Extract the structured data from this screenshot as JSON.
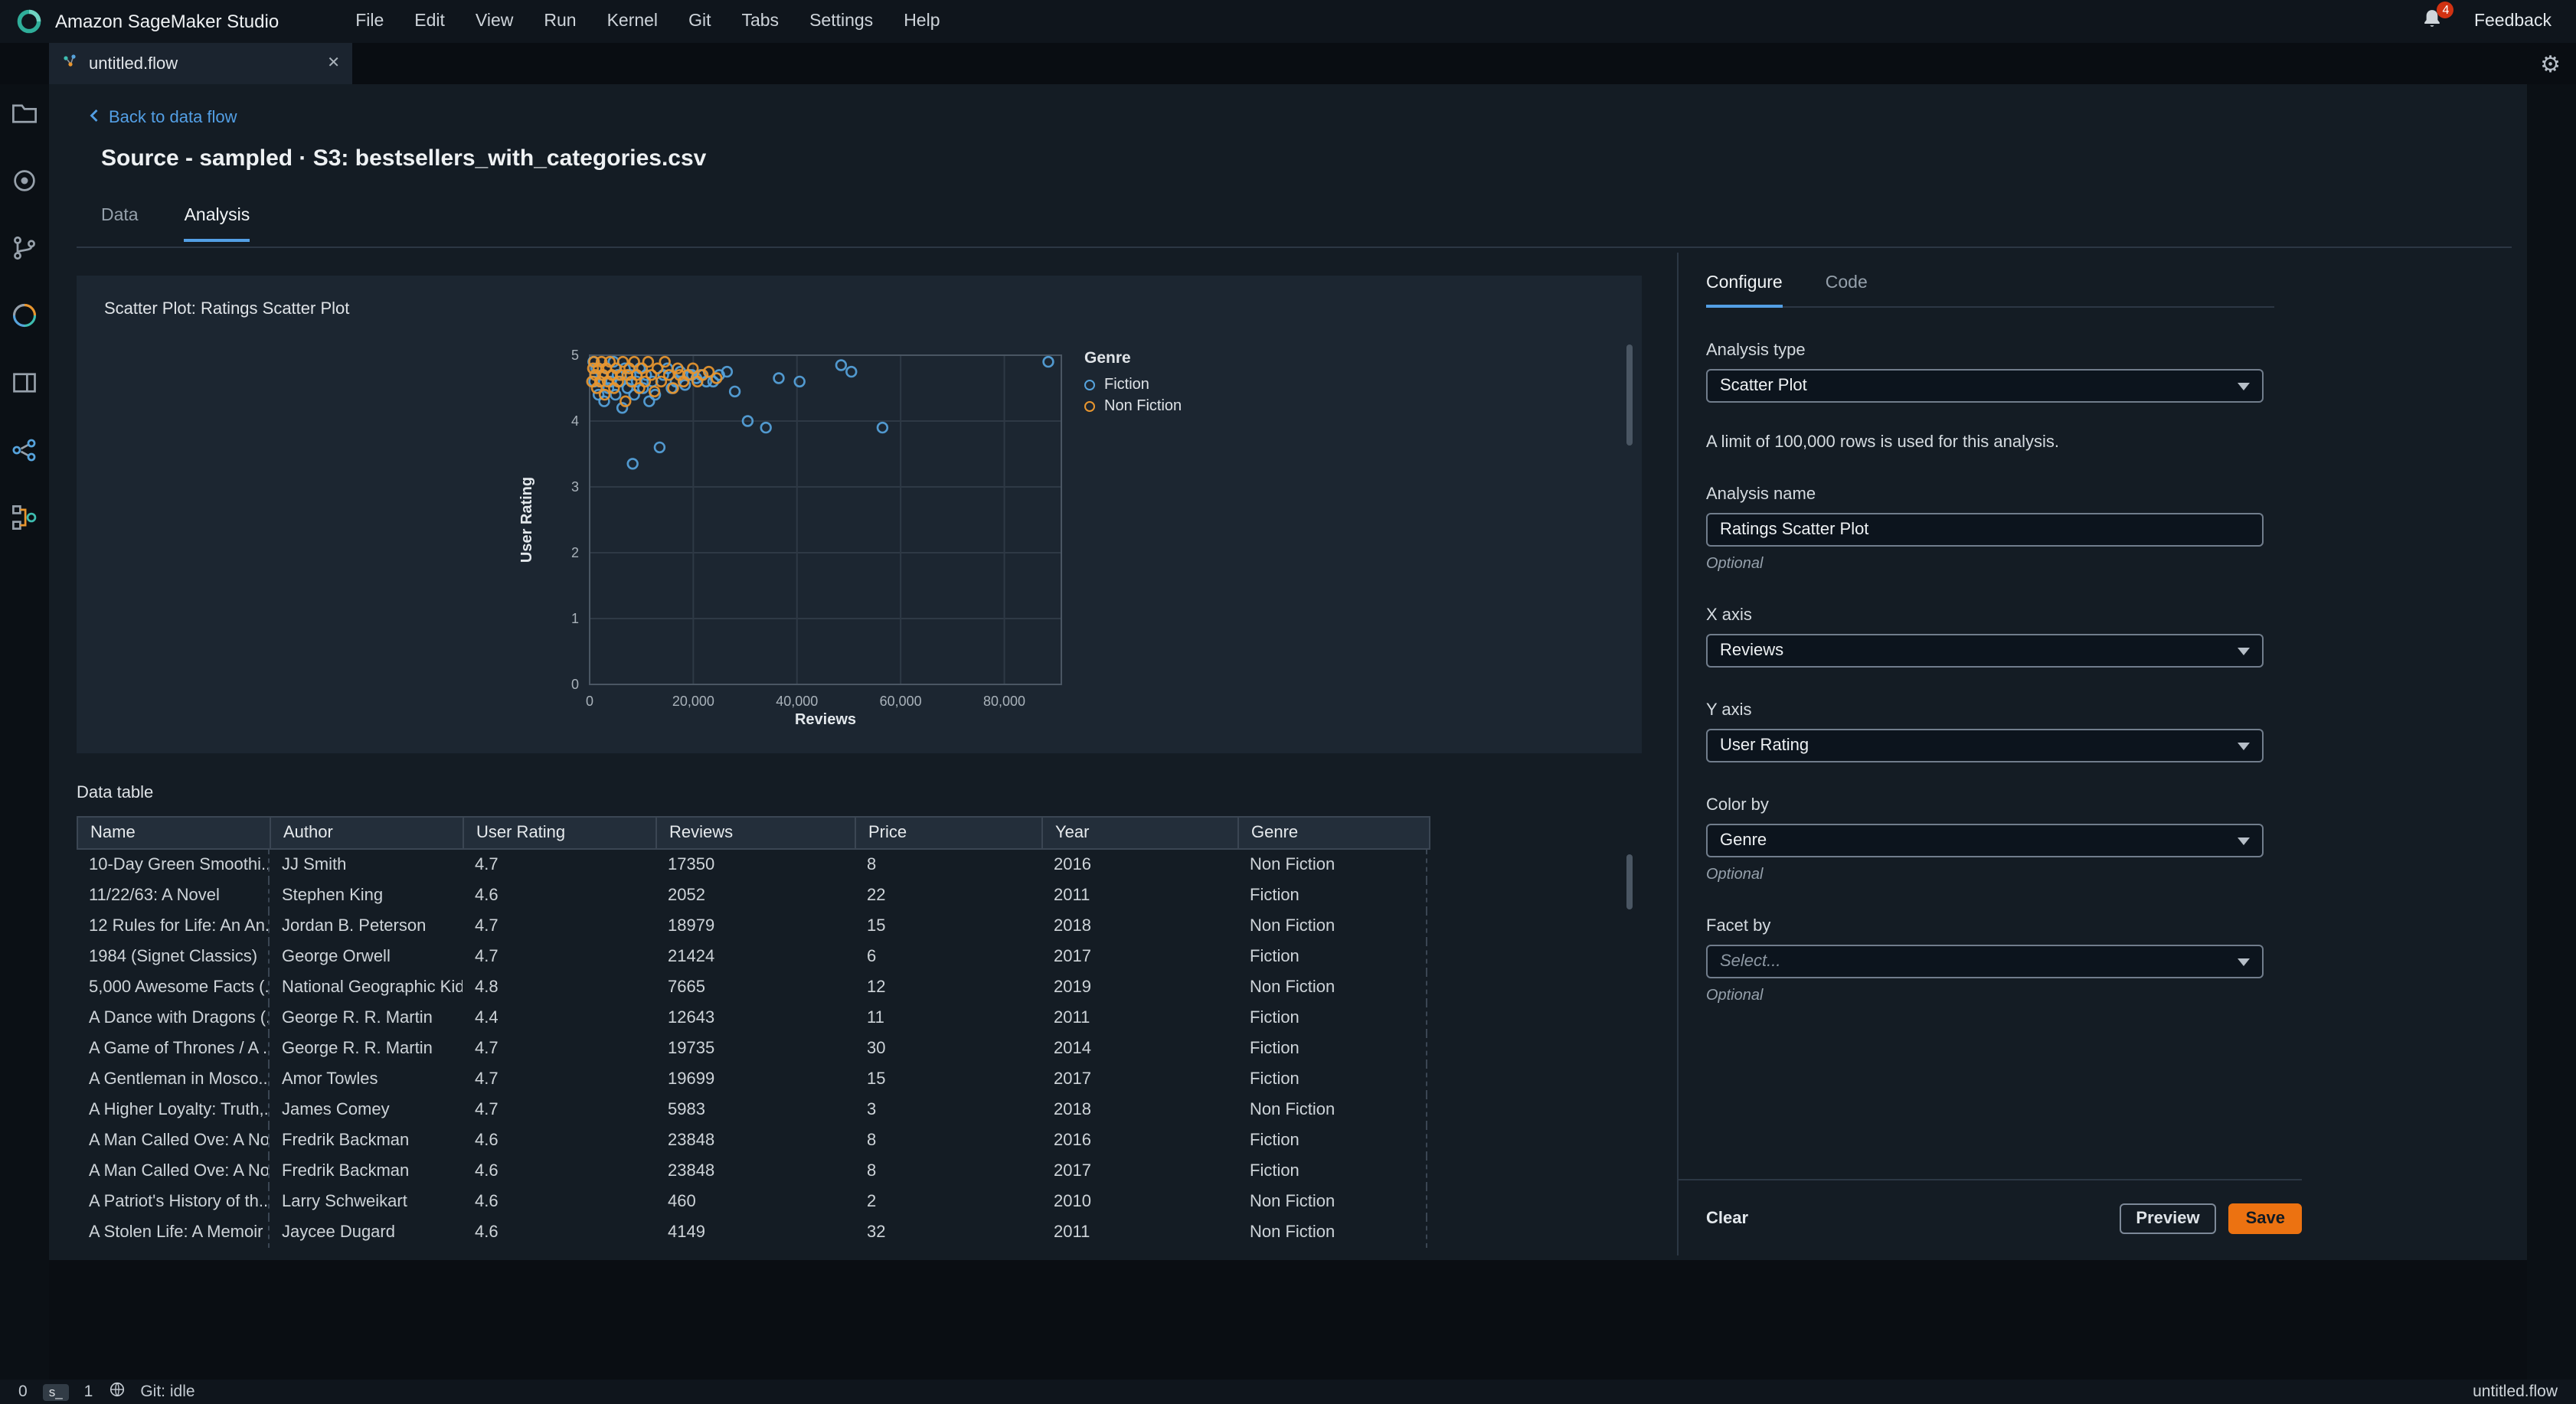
{
  "topbar": {
    "app_title": "Amazon SageMaker Studio",
    "menus": [
      "File",
      "Edit",
      "View",
      "Run",
      "Kernel",
      "Git",
      "Tabs",
      "Settings",
      "Help"
    ],
    "notification_count": "4",
    "feedback_label": "Feedback"
  },
  "tabbar": {
    "tab_title": "untitled.flow",
    "close_glyph": "✕"
  },
  "sidebar": {
    "icons": [
      "folder-icon",
      "running-icon",
      "git-icon",
      "resources-icon",
      "tabs-icon",
      "pipeline-icon",
      "data-flow-icon"
    ]
  },
  "page": {
    "back_link": "Back to data flow",
    "title": "Source - sampled · S3: bestsellers_with_categories.csv",
    "tabs": [
      {
        "label": "Data",
        "active": false
      },
      {
        "label": "Analysis",
        "active": true
      }
    ]
  },
  "chart_panel": {
    "title": "Scatter Plot: Ratings Scatter Plot"
  },
  "chart_data": {
    "type": "scatter",
    "title": "Scatter Plot: Ratings Scatter Plot",
    "xlabel": "Reviews",
    "ylabel": "User Rating",
    "xlim": [
      0,
      91000
    ],
    "ylim": [
      0,
      5
    ],
    "x_ticks": [
      0,
      20000,
      40000,
      60000,
      80000
    ],
    "x_tick_labels": [
      "0",
      "20,000",
      "40,000",
      "60,000",
      "80,000"
    ],
    "y_ticks": [
      0,
      1,
      2,
      3,
      4,
      5
    ],
    "grid": true,
    "legend_title": "Genre",
    "legend_position": "right",
    "series": [
      {
        "name": "Fiction",
        "color": "#56a3dc",
        "points": [
          [
            700,
            4.9
          ],
          [
            900,
            4.6
          ],
          [
            1300,
            4.8
          ],
          [
            1700,
            4.4
          ],
          [
            2052,
            4.6
          ],
          [
            2400,
            4.7
          ],
          [
            2800,
            4.3
          ],
          [
            3200,
            4.8
          ],
          [
            3600,
            4.5
          ],
          [
            4149,
            4.6
          ],
          [
            4600,
            4.9
          ],
          [
            5000,
            4.4
          ],
          [
            5400,
            4.7
          ],
          [
            5900,
            4.6
          ],
          [
            6300,
            4.2
          ],
          [
            6800,
            4.8
          ],
          [
            7300,
            4.5
          ],
          [
            7900,
            4.7
          ],
          [
            8300,
            3.35
          ],
          [
            8600,
            4.4
          ],
          [
            9100,
            4.6
          ],
          [
            9700,
            4.8
          ],
          [
            10300,
            4.5
          ],
          [
            10900,
            4.7
          ],
          [
            11500,
            4.3
          ],
          [
            12100,
            4.6
          ],
          [
            12643,
            4.4
          ],
          [
            13500,
            3.6
          ],
          [
            14200,
            4.7
          ],
          [
            15000,
            4.8
          ],
          [
            15800,
            4.5
          ],
          [
            16600,
            4.6
          ],
          [
            17500,
            4.75
          ],
          [
            18400,
            4.55
          ],
          [
            19300,
            4.7
          ],
          [
            19735,
            4.7
          ],
          [
            20600,
            4.65
          ],
          [
            21424,
            4.7
          ],
          [
            22500,
            4.6
          ],
          [
            23848,
            4.6
          ],
          [
            25000,
            4.7
          ],
          [
            26500,
            4.75
          ],
          [
            28000,
            4.45
          ],
          [
            30500,
            4.0
          ],
          [
            34000,
            3.9
          ],
          [
            36500,
            4.65
          ],
          [
            40500,
            4.6
          ],
          [
            48500,
            4.85
          ],
          [
            50500,
            4.75
          ],
          [
            56500,
            3.9
          ],
          [
            88500,
            4.9
          ]
        ]
      },
      {
        "name": "Non Fiction",
        "color": "#e8962f",
        "points": [
          [
            460,
            4.6
          ],
          [
            650,
            4.8
          ],
          [
            850,
            4.9
          ],
          [
            1100,
            4.7
          ],
          [
            1400,
            4.5
          ],
          [
            1700,
            4.8
          ],
          [
            2000,
            4.6
          ],
          [
            2300,
            4.9
          ],
          [
            2600,
            4.7
          ],
          [
            2900,
            4.4
          ],
          [
            3200,
            4.8
          ],
          [
            3500,
            4.6
          ],
          [
            3900,
            4.9
          ],
          [
            4300,
            4.7
          ],
          [
            4700,
            4.5
          ],
          [
            5100,
            4.8
          ],
          [
            5500,
            4.6
          ],
          [
            5983,
            4.7
          ],
          [
            6400,
            4.9
          ],
          [
            6900,
            4.3
          ],
          [
            7300,
            4.7
          ],
          [
            7665,
            4.8
          ],
          [
            8100,
            4.6
          ],
          [
            8600,
            4.9
          ],
          [
            9100,
            4.7
          ],
          [
            9600,
            4.5
          ],
          [
            10100,
            4.8
          ],
          [
            10700,
            4.6
          ],
          [
            11300,
            4.9
          ],
          [
            11900,
            4.7
          ],
          [
            12500,
            4.45
          ],
          [
            13100,
            4.8
          ],
          [
            13800,
            4.6
          ],
          [
            14500,
            4.9
          ],
          [
            15300,
            4.7
          ],
          [
            16100,
            4.5
          ],
          [
            17000,
            4.8
          ],
          [
            17350,
            4.7
          ],
          [
            18100,
            4.6
          ],
          [
            18979,
            4.7
          ],
          [
            19900,
            4.8
          ],
          [
            20800,
            4.6
          ],
          [
            21800,
            4.7
          ],
          [
            23000,
            4.75
          ],
          [
            24500,
            4.65
          ]
        ]
      }
    ]
  },
  "data_table": {
    "title": "Data table",
    "columns": [
      "Name",
      "Author",
      "User Rating",
      "Reviews",
      "Price",
      "Year",
      "Genre"
    ],
    "rows": [
      {
        "name": "10-Day Green Smoothi...",
        "author": "JJ Smith",
        "rating": "4.7",
        "reviews": "17350",
        "price": "8",
        "year": "2016",
        "genre": "Non Fiction"
      },
      {
        "name": "11/22/63: A Novel",
        "author": "Stephen King",
        "rating": "4.6",
        "reviews": "2052",
        "price": "22",
        "year": "2011",
        "genre": "Fiction"
      },
      {
        "name": "12 Rules for Life: An An...",
        "author": "Jordan B. Peterson",
        "rating": "4.7",
        "reviews": "18979",
        "price": "15",
        "year": "2018",
        "genre": "Non Fiction"
      },
      {
        "name": "1984 (Signet Classics)",
        "author": "George Orwell",
        "rating": "4.7",
        "reviews": "21424",
        "price": "6",
        "year": "2017",
        "genre": "Fiction"
      },
      {
        "name": "5,000 Awesome Facts (...",
        "author": "National Geographic Kids",
        "rating": "4.8",
        "reviews": "7665",
        "price": "12",
        "year": "2019",
        "genre": "Non Fiction"
      },
      {
        "name": "A Dance with Dragons (...",
        "author": "George R. R. Martin",
        "rating": "4.4",
        "reviews": "12643",
        "price": "11",
        "year": "2011",
        "genre": "Fiction"
      },
      {
        "name": "A Game of Thrones / A ...",
        "author": "George R. R. Martin",
        "rating": "4.7",
        "reviews": "19735",
        "price": "30",
        "year": "2014",
        "genre": "Fiction"
      },
      {
        "name": "A Gentleman in Mosco...",
        "author": "Amor Towles",
        "rating": "4.7",
        "reviews": "19699",
        "price": "15",
        "year": "2017",
        "genre": "Fiction"
      },
      {
        "name": "A Higher Loyalty: Truth,...",
        "author": "James Comey",
        "rating": "4.7",
        "reviews": "5983",
        "price": "3",
        "year": "2018",
        "genre": "Non Fiction"
      },
      {
        "name": "A Man Called Ove: A No...",
        "author": "Fredrik Backman",
        "rating": "4.6",
        "reviews": "23848",
        "price": "8",
        "year": "2016",
        "genre": "Fiction"
      },
      {
        "name": "A Man Called Ove: A No...",
        "author": "Fredrik Backman",
        "rating": "4.6",
        "reviews": "23848",
        "price": "8",
        "year": "2017",
        "genre": "Fiction"
      },
      {
        "name": "A Patriot's History of th...",
        "author": "Larry Schweikart",
        "rating": "4.6",
        "reviews": "460",
        "price": "2",
        "year": "2010",
        "genre": "Non Fiction"
      },
      {
        "name": "A Stolen Life: A Memoir",
        "author": "Jaycee Dugard",
        "rating": "4.6",
        "reviews": "4149",
        "price": "32",
        "year": "2011",
        "genre": "Non Fiction"
      }
    ]
  },
  "config_panel": {
    "tabs": [
      {
        "label": "Configure",
        "active": true
      },
      {
        "label": "Code",
        "active": false
      }
    ],
    "analysis_type": {
      "label": "Analysis type",
      "value": "Scatter Plot"
    },
    "limit_note": "A limit of 100,000 rows is used for this analysis.",
    "analysis_name": {
      "label": "Analysis name",
      "value": "Ratings Scatter Plot",
      "optional": "Optional"
    },
    "x_axis": {
      "label": "X axis",
      "value": "Reviews"
    },
    "y_axis": {
      "label": "Y axis",
      "value": "User Rating"
    },
    "color_by": {
      "label": "Color by",
      "value": "Genre",
      "optional": "Optional"
    },
    "facet_by": {
      "label": "Facet by",
      "placeholder": "Select...",
      "optional": "Optional"
    },
    "actions": {
      "clear": "Clear",
      "preview": "Preview",
      "save": "Save"
    }
  },
  "statusbar": {
    "left_count": "0",
    "kernel_badge": "s_",
    "terminal_count": "1",
    "git_status": "Git: idle",
    "file_name": "untitled.flow"
  },
  "colors": {
    "accent_blue": "#539fe5",
    "save_orange": "#ec7211",
    "fiction": "#56a3dc",
    "non_fiction": "#e8962f",
    "notification_red": "#d13212"
  }
}
